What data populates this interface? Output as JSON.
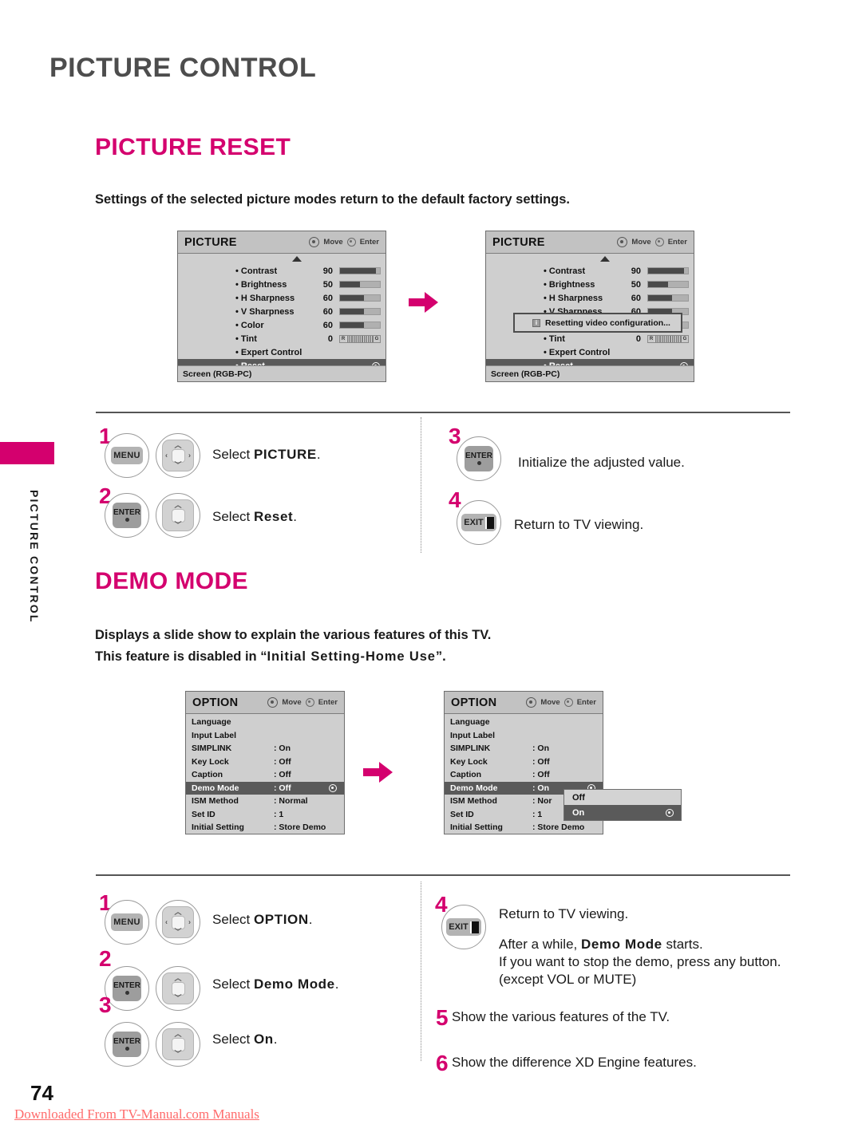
{
  "page": {
    "chapter_title": "PICTURE CONTROL",
    "side_tab_label": "PICTURE CONTROL",
    "page_number": "74",
    "footer_credit": "Downloaded From TV-Manual.com Manuals"
  },
  "picture_reset": {
    "heading": "PICTURE RESET",
    "intro": "Settings of the selected picture modes return to the default factory settings."
  },
  "demo_mode": {
    "heading": "DEMO MODE",
    "intro_line1": "Displays a slide show to explain the various features of this TV.",
    "intro_line2_prefix": "This feature is disabled in “",
    "intro_line2_bold": "Initial Setting-Home Use",
    "intro_line2_suffix": "”."
  },
  "picture_osd": {
    "title": "PICTURE",
    "hint_move": "Move",
    "hint_enter": "Enter",
    "footer": "Screen (RGB-PC)",
    "rows": [
      {
        "label": "• Contrast",
        "value": "90",
        "bar": 90
      },
      {
        "label": "• Brightness",
        "value": "50",
        "bar": 50
      },
      {
        "label": "• H Sharpness",
        "value": "60",
        "bar": 60
      },
      {
        "label": "• V Sharpness",
        "value": "60",
        "bar": 60
      },
      {
        "label": "• Color",
        "value": "60",
        "bar": 60
      },
      {
        "label": "• Tint",
        "value": "0",
        "bar": -1,
        "tint": true,
        "tint_left": "R",
        "tint_right": "G"
      },
      {
        "label": "• Expert Control",
        "value": "",
        "bar": -1
      },
      {
        "label": "• Reset",
        "value": "",
        "bar": -1,
        "selected": true,
        "radio": true
      }
    ],
    "reset_popup": {
      "icon": "info-icon",
      "message": "Resetting video configuration..."
    }
  },
  "option_osd": {
    "title": "OPTION",
    "hint_move": "Move",
    "hint_enter": "Enter",
    "rows_before": [
      {
        "key": "Language",
        "value": ""
      },
      {
        "key": "Input Label",
        "value": ""
      },
      {
        "key": "SIMPLINK",
        "value": ": On"
      },
      {
        "key": "Key Lock",
        "value": ": Off"
      },
      {
        "key": "Caption",
        "value": ": Off"
      },
      {
        "key": "Demo Mode",
        "value": ": Off",
        "selected": true,
        "radio": true
      },
      {
        "key": "ISM Method",
        "value": ": Normal"
      },
      {
        "key": "Set ID",
        "value": ": 1"
      },
      {
        "key": "Initial Setting",
        "value": ": Store Demo"
      }
    ],
    "rows_after": [
      {
        "key": "Language",
        "value": ""
      },
      {
        "key": "Input Label",
        "value": ""
      },
      {
        "key": "SIMPLINK",
        "value": ": On"
      },
      {
        "key": "Key Lock",
        "value": ": Off"
      },
      {
        "key": "Caption",
        "value": ": Off"
      },
      {
        "key": "Demo Mode",
        "value": ": On",
        "selected": true,
        "radio": true
      },
      {
        "key": "ISM Method",
        "value": ": Nor"
      },
      {
        "key": "Set ID",
        "value": ": 1"
      },
      {
        "key": "Initial Setting",
        "value": ": Store Demo"
      }
    ],
    "dropdown": {
      "options": [
        {
          "label": "Off",
          "selected": false
        },
        {
          "label": "On",
          "selected": true
        }
      ]
    }
  },
  "reset_steps": {
    "s1": {
      "num": "1",
      "key": "MENU",
      "prefix": "Select ",
      "bold": "PICTURE",
      "suffix": "."
    },
    "s2": {
      "num": "2",
      "key": "ENTER",
      "prefix": "Select ",
      "bold": "Reset",
      "suffix": "."
    },
    "s3": {
      "num": "3",
      "key": "ENTER",
      "text": "Initialize the adjusted value."
    },
    "s4": {
      "num": "4",
      "key": "EXIT",
      "text": "Return to TV viewing."
    }
  },
  "demo_steps": {
    "s1": {
      "num": "1",
      "key": "MENU",
      "prefix": "Select ",
      "bold": "OPTION",
      "suffix": "."
    },
    "s2": {
      "num": "2",
      "key": "ENTER",
      "prefix": "Select ",
      "bold": "Demo Mode",
      "suffix": "."
    },
    "s3": {
      "num": "3",
      "key": "ENTER",
      "prefix": "Select ",
      "bold": "On",
      "suffix": "."
    },
    "s4": {
      "num": "4",
      "key": "EXIT",
      "line1": "Return to TV viewing.",
      "line2_prefix": "After a while, ",
      "line2_bold": "Demo Mode",
      "line2_suffix": " starts.",
      "line3": "If you want to stop the demo, press any button.",
      "line4": "(except VOL or MUTE)"
    },
    "s5": {
      "num": "5",
      "text": "Show the various features of the TV."
    },
    "s6": {
      "num": "6",
      "text": "Show the difference XD Engine features."
    }
  },
  "colors": {
    "accent": "#d4006e",
    "title_gray": "#4d4d4d",
    "osd_bg": "#cfcfcf",
    "osd_selected": "#5a5a5a"
  }
}
